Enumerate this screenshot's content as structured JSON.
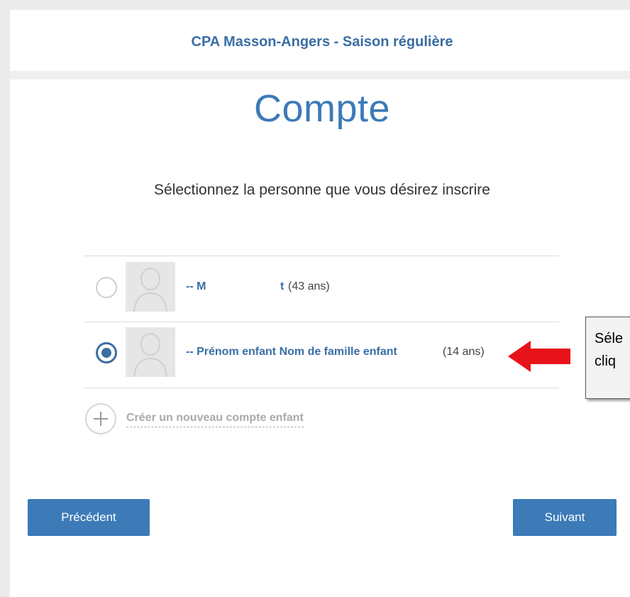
{
  "header": {
    "org_title": "CPA Masson-Angers - Saison régulière"
  },
  "main": {
    "page_title": "Compte",
    "instruction": "Sélectionnez la personne que vous désirez inscrire"
  },
  "people": [
    {
      "name_prefix": "-- M",
      "name_suffix": "t",
      "age": "(43 ans)",
      "selected": false
    },
    {
      "name": "-- Prénom enfant Nom de famille enfant",
      "age": "(14 ans)",
      "selected": true
    }
  ],
  "add_account": {
    "label": "Créer un nouveau compte enfant"
  },
  "buttons": {
    "previous": "Précédent",
    "next": "Suivant"
  },
  "callout": {
    "line1": "Séle",
    "line2": "cliq"
  },
  "colors": {
    "accent": "#3c7ab8",
    "arrow": "#e8131a"
  },
  "icons": {
    "avatar": "user-avatar-icon",
    "add": "plus-circle-icon",
    "arrow": "arrow-left-icon"
  }
}
